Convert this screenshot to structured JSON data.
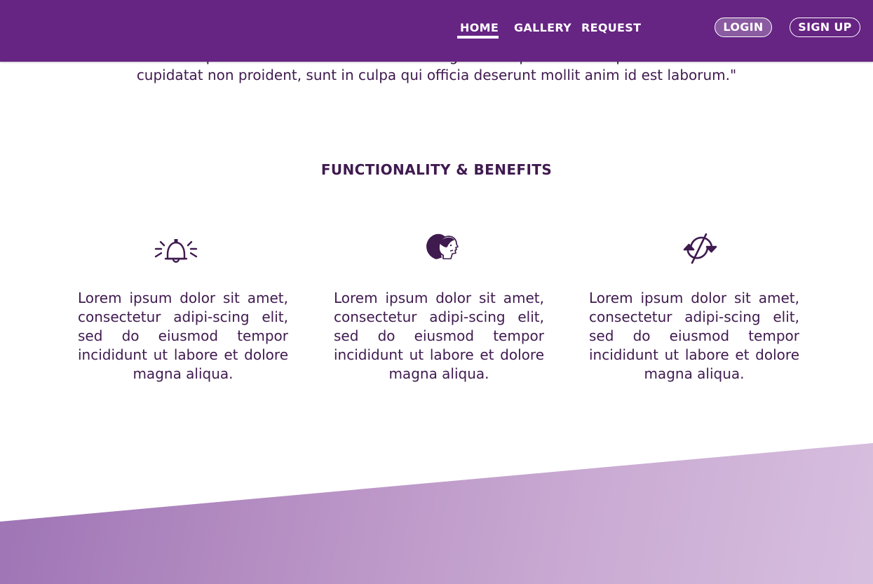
{
  "nav": {
    "home": "HOME",
    "gallery": "GALLERY",
    "request": "REQUEST",
    "login": "LOGIN",
    "signup": "SIGN UP"
  },
  "quote": {
    "line1": "derit in voluptate velit esse cillum dolore eu fugiat nulla pariatur. Excepteur sint occaecat",
    "line2": "cupidatat non proident, sunt in culpa qui officia deserunt mollit anim id est laborum.\""
  },
  "section": {
    "title": "FUNCTIONALITY & BENEFITS"
  },
  "features": [
    {
      "icon": "bell-icon",
      "text": "Lorem ipsum dolor sit amet, consectetur adipi-scing elit, sed do eiusmod tempor incididunt ut labore et dolore magna aliqua."
    },
    {
      "icon": "people-icon",
      "text": "Lorem ipsum dolor sit amet, consectetur adipi-scing elit, sed do eiusmod tempor incididunt ut labore et dolore magna aliqua."
    },
    {
      "icon": "sync-icon",
      "text": "Lorem ipsum dolor sit amet, consectetur adipi-scing elit, sed do eiusmod tempor incididunt ut labore et dolore magna aliqua."
    }
  ],
  "colors": {
    "header": "#662483",
    "text": "#3f1a4f",
    "band_start": "#9e74b5",
    "band_end": "#d7bfdf"
  }
}
